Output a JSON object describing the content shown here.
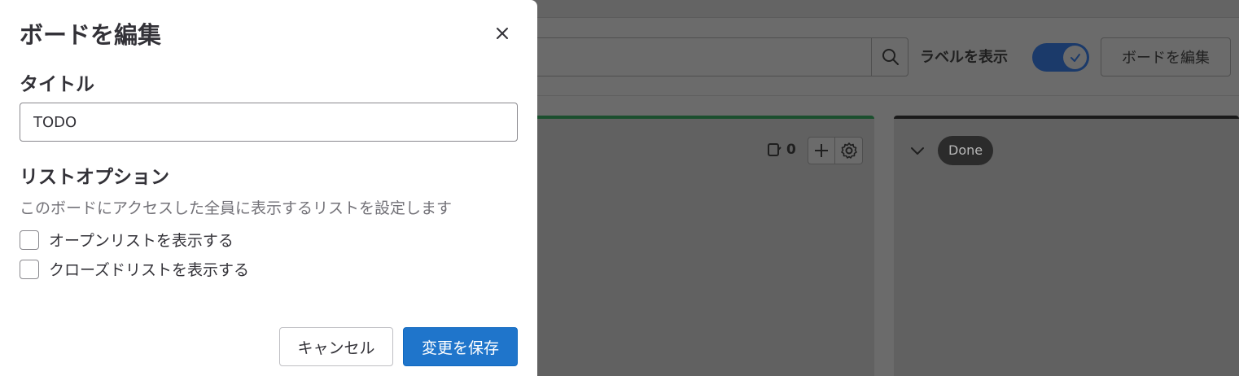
{
  "background": {
    "show_labels_text": "ラベルを表示",
    "edit_board_button": "ボードを編集",
    "list_open": {
      "issue_count": "0"
    },
    "list_closed": {
      "badge": "Done"
    },
    "toggle_on": true
  },
  "modal": {
    "title": "ボードを編集",
    "title_field": {
      "label": "タイトル",
      "value": "TODO"
    },
    "list_options": {
      "heading": "リストオプション",
      "description": "このボードにアクセスした全員に表示するリストを設定します",
      "options": [
        {
          "label": "オープンリストを表示する",
          "checked": false
        },
        {
          "label": "クローズドリストを表示する",
          "checked": false
        }
      ]
    },
    "cancel_label": "キャンセル",
    "save_label": "変更を保存"
  },
  "colors": {
    "primary": "#1f75cb",
    "overlay": "#6b6b6b",
    "open_list_accent": "#1b4f2e",
    "closed_list_accent": "#1a1a1a"
  }
}
